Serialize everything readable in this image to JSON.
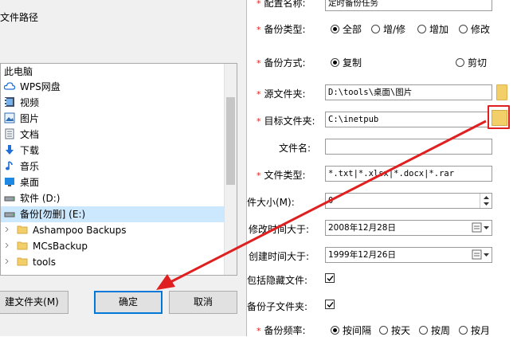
{
  "dialog": {
    "title": "文件路径",
    "tree": [
      {
        "label": "此电脑",
        "icon": "computer-icon"
      },
      {
        "label": "WPS网盘",
        "icon": "cloud-icon"
      },
      {
        "label": "视频",
        "icon": "video-folder-icon"
      },
      {
        "label": "图片",
        "icon": "pictures-folder-icon"
      },
      {
        "label": "文档",
        "icon": "documents-folder-icon"
      },
      {
        "label": "下载",
        "icon": "download-icon"
      },
      {
        "label": "音乐",
        "icon": "music-icon"
      },
      {
        "label": "桌面",
        "icon": "desktop-icon"
      },
      {
        "label": "软件 (D:)",
        "icon": "drive-icon"
      },
      {
        "label": "备份[勿删] (E:)",
        "icon": "drive-icon"
      },
      {
        "label": "Ashampoo Backups",
        "icon": "folder-icon"
      },
      {
        "label": "MCsBackup",
        "icon": "folder-icon"
      },
      {
        "label": "tools",
        "icon": "folder-icon"
      }
    ],
    "new_folder_label": "建文件夹(M)",
    "ok_label": "确定",
    "cancel_label": "取消"
  },
  "form": {
    "task_name_label": "配置名称:",
    "task_name_value": "定时备份任务",
    "backup_type_label": "备份类型:",
    "backup_type_options": [
      "全部",
      "增/修",
      "增加",
      "修改"
    ],
    "backup_method_label": "备份方式:",
    "backup_method_options": [
      "复制",
      "剪切"
    ],
    "source_label": "源文件夹:",
    "source_value": "D:\\tools\\桌面\\图片",
    "target_label": "目标文件夹:",
    "target_value": "C:\\inetpub",
    "filename_label": "文件名:",
    "filename_value": "",
    "filetype_label": "文件类型:",
    "filetype_value": "*.txt|*.xlsx|*.docx|*.rar",
    "size_label": "文件大小(M):",
    "size_value": "0",
    "modified_label": "修改时间大于:",
    "modified_value": "2008年12月28日",
    "created_label": "创建时间大于:",
    "created_value": "1999年12月26日",
    "hidden_label": "包括隐藏文件:",
    "subfolder_label": "备份子文件夹:",
    "frequency_label": "备份频率:",
    "frequency_options": [
      "按间隔",
      "按天",
      "按周",
      "按月"
    ]
  },
  "colors": {
    "required": "#e02020",
    "arrow": "#e02020",
    "highlight": "#0078d7",
    "selection": "#cce8ff"
  }
}
